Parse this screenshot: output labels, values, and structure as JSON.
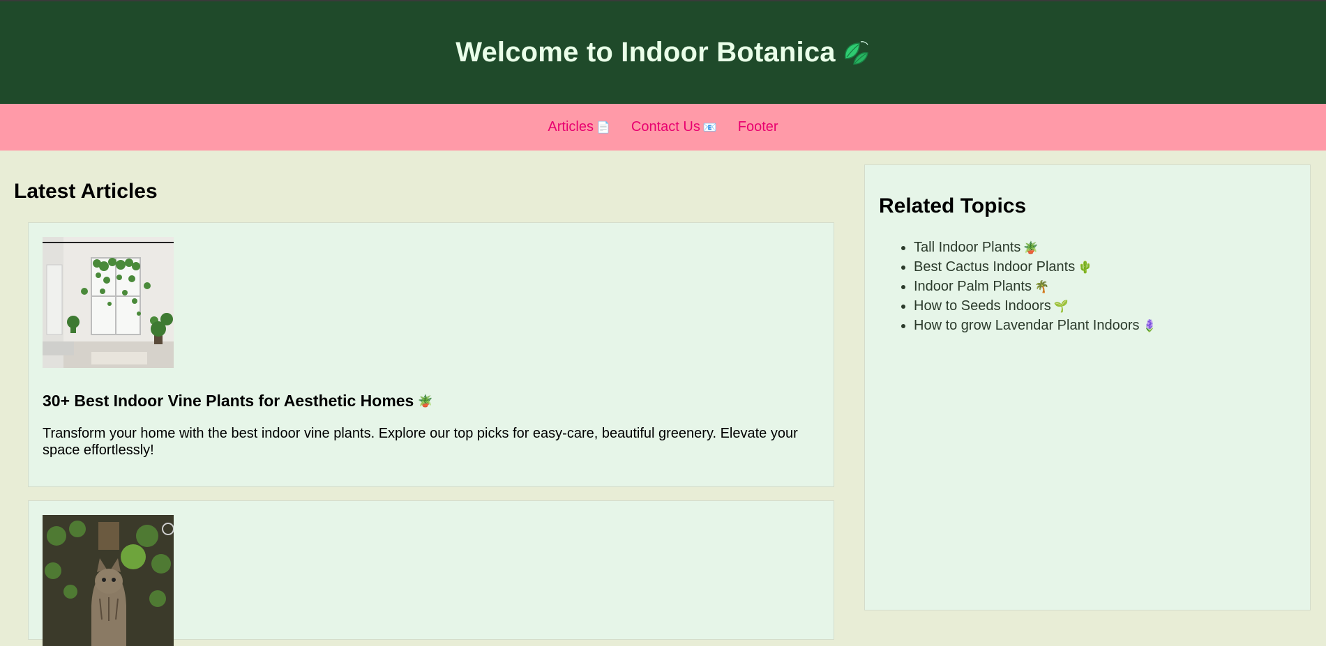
{
  "header": {
    "title": "Welcome to Indoor Botanica",
    "title_icon": "leaf-icon"
  },
  "nav": {
    "items": [
      {
        "label": "Articles",
        "icon": "📄"
      },
      {
        "label": "Contact Us",
        "icon": "📧"
      },
      {
        "label": "Footer",
        "icon": ""
      }
    ]
  },
  "main": {
    "heading": "Latest Articles",
    "articles": [
      {
        "title": "30+ Best Indoor Vine Plants for Aesthetic Homes",
        "title_icon": "🪴",
        "description": "Transform your home with the best indoor vine plants. Explore our top picks for easy-care, beautiful greenery. Elevate your space effortlessly!",
        "image": "hanging-vine-plants-room-photo"
      },
      {
        "title": "",
        "title_icon": "",
        "description": "",
        "image": "cat-with-plants-photo"
      }
    ]
  },
  "sidebar": {
    "heading": "Related Topics",
    "topics": [
      {
        "label": "Tall Indoor Plants",
        "icon": "🪴"
      },
      {
        "label": "Best Cactus Indoor Plants",
        "icon": "🌵"
      },
      {
        "label": "Indoor Palm Plants",
        "icon": "🌴"
      },
      {
        "label": "How to Seeds Indoors",
        "icon": "🌱"
      },
      {
        "label": "How to grow Lavendar Plant Indoors",
        "icon": "🪻"
      }
    ]
  },
  "colors": {
    "header_bg": "#1f4a2a",
    "nav_bg": "#ff9aa8",
    "nav_link": "#e8006f",
    "page_bg": "#e8edd6",
    "card_bg": "#e6f5e8"
  }
}
